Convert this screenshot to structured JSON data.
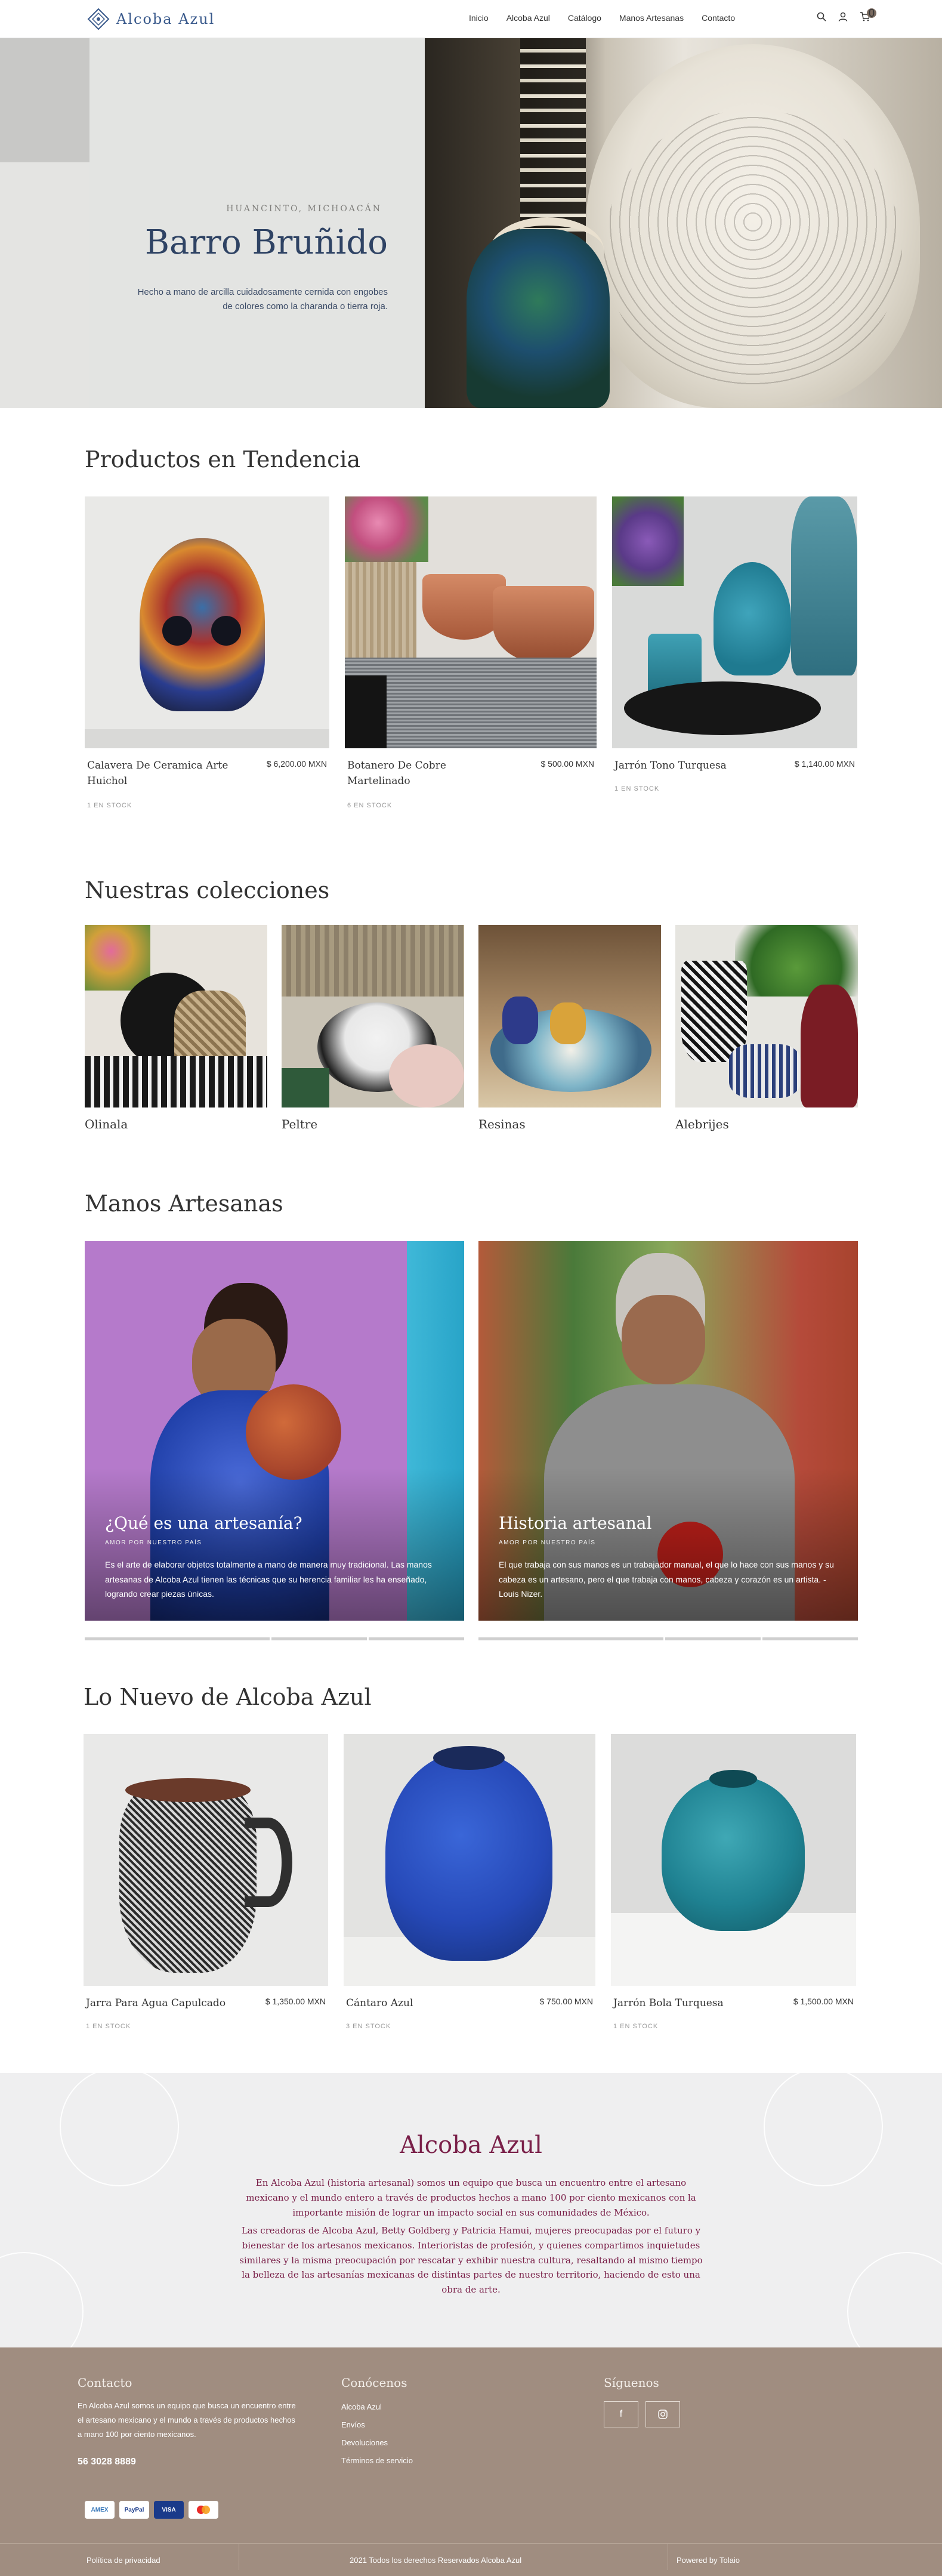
{
  "brand": {
    "name": "Alcoba Azul",
    "logo_color": "#3a5a8c"
  },
  "nav": [
    "Inicio",
    "Alcoba Azul",
    "Catálogo",
    "Manos Artesanas",
    "Contacto"
  ],
  "header_icons": [
    "search-icon",
    "user-icon",
    "cart-icon"
  ],
  "cart_count": "0",
  "hero": {
    "subtitle": "HUANCINTO, MICHOACÁN",
    "title": "Barro Bruñido",
    "description": "Hecho a mano de arcilla cuidadosamente cernida con engobes de colores como la charanda o tierra roja.",
    "slides": 5,
    "active_slide": 2
  },
  "trending": {
    "title": "Productos en Tendencia",
    "items": [
      {
        "name": "Calavera De Ceramica Arte Huichol",
        "price": "$ 6,200.00 MXN",
        "stock": "1 EN STOCK"
      },
      {
        "name": "Botanero De Cobre Martelinado",
        "price": "$ 500.00 MXN",
        "stock": "6 EN STOCK"
      },
      {
        "name": "Jarrón Tono Turquesa",
        "price": "$ 1,140.00 MXN",
        "stock": "1 EN STOCK"
      }
    ]
  },
  "collections": {
    "title": "Nuestras colecciones",
    "items": [
      "Olinala",
      "Peltre",
      "Resinas",
      "Alebrijes"
    ]
  },
  "artisans": {
    "title": "Manos Artesanas",
    "cards": [
      {
        "title": "¿Qué es una artesanía?",
        "subtitle": "AMOR POR NUESTRO PAÍS",
        "text": "Es el arte de elaborar objetos totalmente a mano de manera muy tradicional. Las manos artesanas de Alcoba Azul tienen las técnicas que su herencia familiar les ha enseñado, logrando crear piezas únicas."
      },
      {
        "title": "Historia artesanal",
        "subtitle": "AMOR POR NUESTRO PAÍS",
        "text": "El que trabaja con sus manos es un trabajador manual, el que lo hace con sus manos y su cabeza es un artesano, pero el que trabaja con manos, cabeza y corazón es un artista. - Louis Nizer."
      }
    ]
  },
  "new_items": {
    "title": "Lo Nuevo de Alcoba Azul",
    "items": [
      {
        "name": "Jarra Para Agua Capulcado",
        "price": "$ 1,350.00 MXN",
        "stock": "1 EN STOCK"
      },
      {
        "name": "Cántaro Azul",
        "price": "$ 750.00 MXN",
        "stock": "3 EN STOCK"
      },
      {
        "name": "Jarrón Bola Turquesa",
        "price": "$ 1,500.00 MXN",
        "stock": "1 EN STOCK"
      }
    ]
  },
  "about": {
    "title": "Alcoba Azul",
    "p1": "En Alcoba Azul (historia artesanal) somos un equipo que busca un encuentro entre el artesano mexicano y el mundo entero a través de productos hechos a mano 100 por ciento mexicanos con la importante misión de lograr un impacto social en sus comunidades de México.",
    "p2": "Las creadoras de Alcoba Azul, Betty Goldberg y Patricia Hamui, mujeres preocupadas por el futuro y bienestar de los artesanos mexicanos. Interioristas de profesión, y quienes compartimos inquietudes similares y la misma preocupación por rescatar y exhibir nuestra cultura, resaltando al mismo tiempo la belleza de las artesanías mexicanas de distintas partes de nuestro territorio, haciendo de esto una obra de arte.",
    "text_color": "#7a2049"
  },
  "footer": {
    "contact_title": "Contacto",
    "contact_text": "En Alcoba Azul somos un equipo que busca un encuentro entre el artesano mexicano y el mundo a través de productos hechos a mano 100 por ciento mexicanos.",
    "phone": "56 3028 8889",
    "know_title": "Conócenos",
    "links": [
      "Alcoba Azul",
      "Envíos",
      "Devoluciones",
      "Términos de servicio"
    ],
    "follow_title": "Síguenos",
    "social": [
      "facebook-icon",
      "instagram-icon"
    ],
    "payments": [
      "AMEX",
      "PayPal",
      "VISA",
      "mastercard-icon"
    ],
    "privacy": "Política de privacidad",
    "copyright": "2021 Todos los derechos Reservados Alcoba Azul",
    "powered": "Powered by Tolaio",
    "bg_color": "#a08d80"
  }
}
